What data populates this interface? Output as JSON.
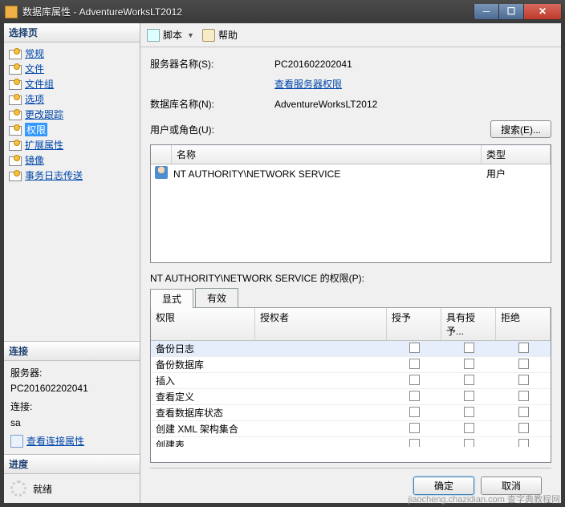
{
  "title": "数据库属性 - AdventureWorksLT2012",
  "watermark": "jiaocheng.chazidian.com 查字典教程网",
  "left": {
    "select_page": "选择页",
    "nav": [
      {
        "label": "常规"
      },
      {
        "label": "文件"
      },
      {
        "label": "文件组"
      },
      {
        "label": "选项"
      },
      {
        "label": "更改跟踪"
      },
      {
        "label": "权限",
        "selected": true
      },
      {
        "label": "扩展属性"
      },
      {
        "label": "镜像"
      },
      {
        "label": "事务日志传送"
      }
    ],
    "connection_header": "连接",
    "server_label": "服务器:",
    "server_value": "PC201602202041",
    "conn_label": "连接:",
    "conn_value": "sa",
    "view_conn": "查看连接属性",
    "progress_header": "进度",
    "progress_status": "就绪"
  },
  "toolbar": {
    "script": "脚本",
    "help": "帮助"
  },
  "form": {
    "server_name_label": "服务器名称(S):",
    "server_name_value": "PC201602202041",
    "view_server_perm": "查看服务器权限",
    "db_name_label": "数据库名称(N):",
    "db_name_value": "AdventureWorksLT2012",
    "users_label": "用户或角色(U):",
    "search_btn": "搜索(E)..."
  },
  "grid": {
    "col_name": "名称",
    "col_type": "类型",
    "rows": [
      {
        "name": "NT AUTHORITY\\NETWORK SERVICE",
        "type": "用户"
      }
    ]
  },
  "perm": {
    "label": "NT AUTHORITY\\NETWORK SERVICE 的权限(P):",
    "tab_explicit": "显式",
    "tab_effective": "有效",
    "col_perm": "权限",
    "col_grantor": "授权者",
    "col_grant": "授予",
    "col_wgrant": "具有授予...",
    "col_deny": "拒绝",
    "rows": [
      "备份日志",
      "备份数据库",
      "插入",
      "查看定义",
      "查看数据库状态",
      "创建 XML 架构集合",
      "创建表"
    ]
  },
  "footer": {
    "ok": "确定",
    "cancel": "取消"
  }
}
